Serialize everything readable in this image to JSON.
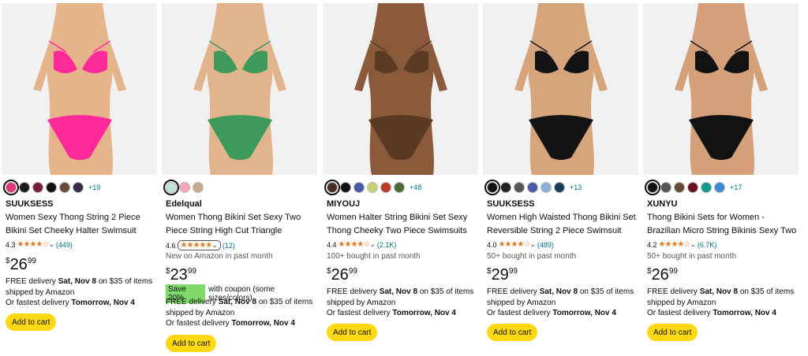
{
  "products": [
    {
      "brand": "SUUKSESS",
      "title": "Women Sexy Thong String 2 Piece Bikini Set Cheeky Halter Swimsuit",
      "rating_value": "4.3",
      "stars": "★★★★☆",
      "review_count": "(449)",
      "bought": "",
      "price_symbol": "$",
      "price_whole": "26",
      "price_cents": "99",
      "coupon_badge": "",
      "coupon_text": "",
      "delivery_line1_a": "FREE delivery ",
      "delivery_date": "Sat, Nov 8",
      "delivery_line1_b": " on $35 of items",
      "delivery_line2": "shipped by Amazon",
      "fastest_prefix": "Or fastest delivery ",
      "fastest_date": "Tomorrow, Nov 4",
      "cart_label": "Add to cart",
      "more_colors": "+19",
      "swatch_colors": [
        "#e4387c",
        "#1a1a1a",
        "#7a1a3a",
        "#111111",
        "#6b4a3a",
        "#3a2a4a"
      ],
      "bikini_color": "#ff2a9a",
      "skin_color": "#e6b48a"
    },
    {
      "brand": "Edelqual",
      "title": "Women Thong Bikini Set Sexy Two Piece String High Cut Triangle Swimsuit",
      "rating_value": "4.6",
      "stars": "★★★★★",
      "review_count": "(12)",
      "bought": "New on Amazon in past month",
      "price_symbol": "$",
      "price_whole": "23",
      "price_cents": "99",
      "coupon_badge": "Save 20%",
      "coupon_text": "with coupon (some sizes/colors)",
      "delivery_line1_a": "FREE delivery ",
      "delivery_date": "Sat, Nov 8",
      "delivery_line1_b": " on $35 of items",
      "delivery_line2": "shipped by Amazon",
      "fastest_prefix": "Or fastest delivery ",
      "fastest_date": "Tomorrow, Nov 4",
      "cart_label": "Add to cart",
      "more_colors": "",
      "swatch_colors": [
        "#bfe3d8",
        "#f2a7b6",
        "#c9a98c"
      ],
      "bikini_color": "#3e9a5a",
      "skin_color": "#e2b48e"
    },
    {
      "brand": "MIYOUJ",
      "title": "Women Halter String Bikini Set Sexy Thong Cheeky Two Piece Swimsuits Bathing Suits",
      "rating_value": "4.4",
      "stars": "★★★★☆",
      "review_count": "(2.1K)",
      "bought": "100+ bought in past month",
      "price_symbol": "$",
      "price_whole": "26",
      "price_cents": "99",
      "coupon_badge": "",
      "coupon_text": "",
      "delivery_line1_a": "FREE delivery ",
      "delivery_date": "Sat, Nov 8",
      "delivery_line1_b": " on $35 of items",
      "delivery_line2": "shipped by Amazon",
      "fastest_prefix": "Or fastest delivery ",
      "fastest_date": "Tomorrow, Nov 4",
      "cart_label": "Add to cart",
      "more_colors": "+48",
      "swatch_colors": [
        "#4a2e22",
        "#111111",
        "#4a5aa8",
        "#c8d07a",
        "#c03a2a",
        "#4a6a3a"
      ],
      "bikini_color": "#5a3a22",
      "skin_color": "#8a5a3a"
    },
    {
      "brand": "SUUKSESS",
      "title": "Women High Waisted Thong Bikini Set Reversible String 2 Piece Swimsuit",
      "rating_value": "4.0",
      "stars": "★★★★☆",
      "review_count": "(489)",
      "bought": "50+ bought in past month",
      "price_symbol": "$",
      "price_whole": "29",
      "price_cents": "99",
      "coupon_badge": "",
      "coupon_text": "",
      "delivery_line1_a": "FREE delivery ",
      "delivery_date": "Sat, Nov 8",
      "delivery_line1_b": " on $35 of items",
      "delivery_line2": "shipped by Amazon",
      "fastest_prefix": "Or fastest delivery ",
      "fastest_date": "Tomorrow, Nov 4",
      "cart_label": "Add to cart",
      "more_colors": "+13",
      "swatch_colors": [
        "#111111",
        "#222222",
        "#555555",
        "#4a5aa8",
        "#8ab0d8",
        "#1a3a5a"
      ],
      "bikini_color": "#141414",
      "skin_color": "#d7a57c"
    },
    {
      "brand": "XUNYU",
      "title": "Thong Bikini Sets for Women - Brazilian Micro String Bikinis Sexy Two Piece Swimsuit",
      "rating_value": "4.2",
      "stars": "★★★★☆",
      "review_count": "(6.7K)",
      "bought": "50+ bought in past month",
      "price_symbol": "$",
      "price_whole": "26",
      "price_cents": "99",
      "coupon_badge": "",
      "coupon_text": "",
      "delivery_line1_a": "FREE delivery ",
      "delivery_date": "Sat, Nov 8",
      "delivery_line1_b": " on $35 of items",
      "delivery_line2": "shipped by Amazon",
      "fastest_prefix": "Or fastest delivery ",
      "fastest_date": "Tomorrow, Nov 4",
      "cart_label": "Add to cart",
      "more_colors": "+17",
      "swatch_colors": [
        "#111111",
        "#555555",
        "#6a4a3a",
        "#6a1020",
        "#109a8a",
        "#3a8ad0"
      ],
      "bikini_color": "#121212",
      "skin_color": "#d4a07a"
    }
  ]
}
